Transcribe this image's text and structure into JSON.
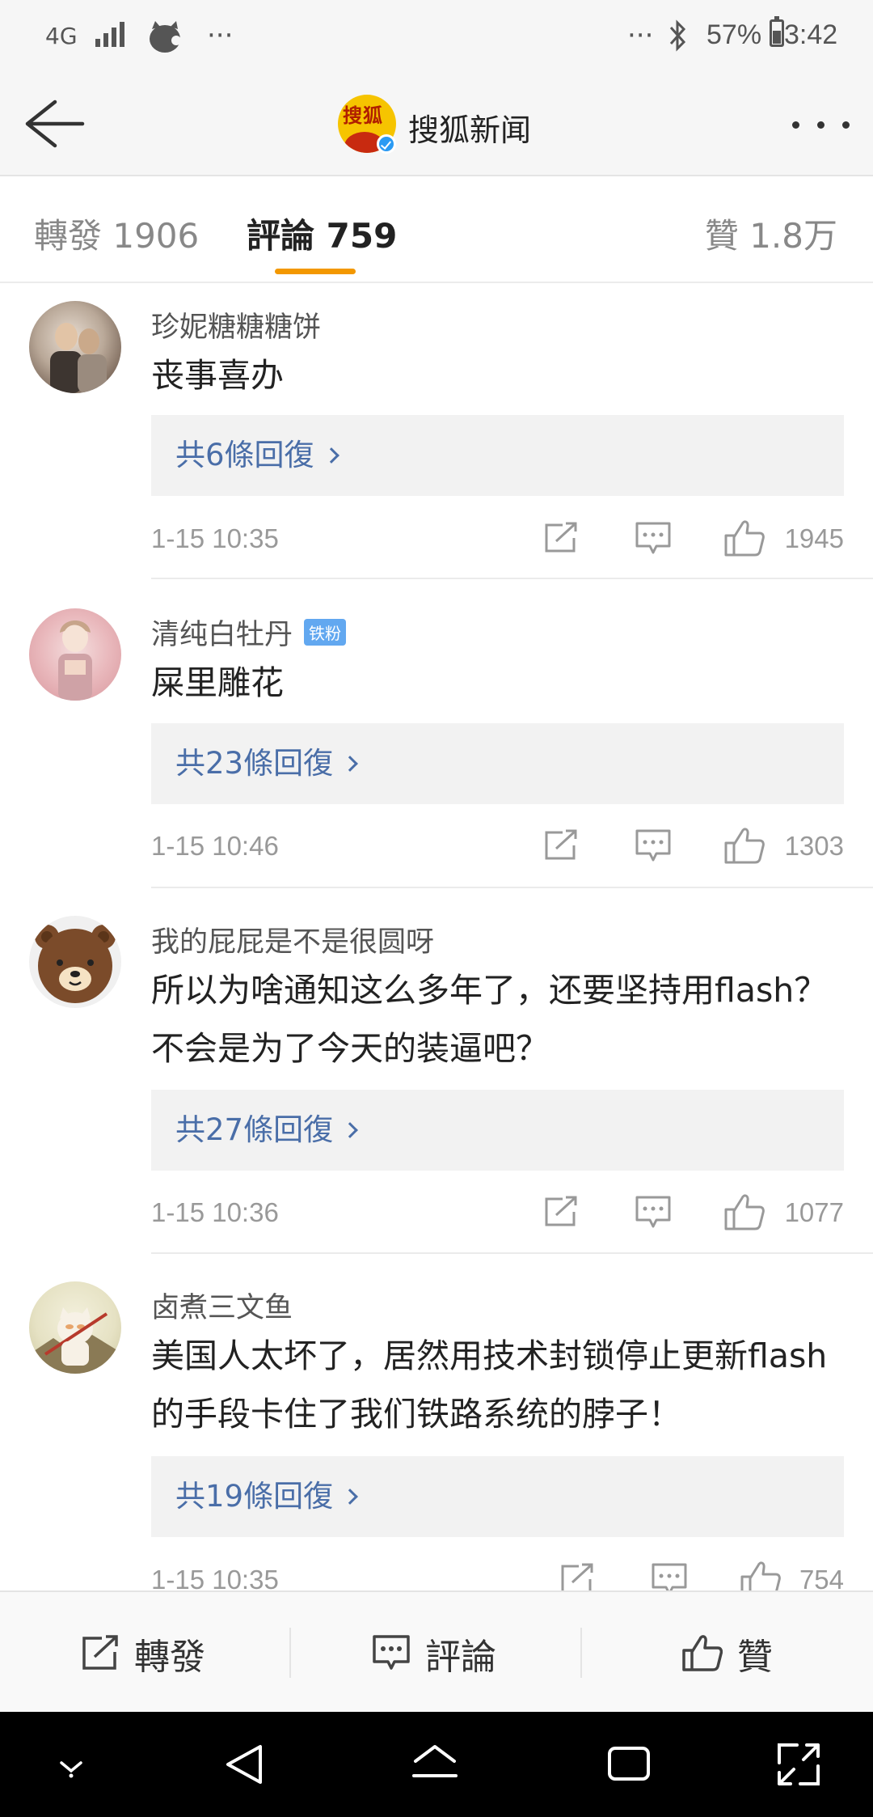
{
  "status_bar": {
    "network": "4G",
    "overflow_left": "···",
    "overflow_right": "···",
    "battery_percent": "57%",
    "battery_level": 0.57,
    "time": "3:42",
    "icons": [
      "signal-bars-icon",
      "cat-app-icon",
      "bluetooth-icon",
      "battery-icon"
    ]
  },
  "header": {
    "title": "搜狐新闻",
    "logo_text": "搜狐",
    "icons": [
      "back-arrow-icon",
      "verified-icon",
      "more-dots-icon"
    ]
  },
  "tabs": [
    {
      "label": "轉發 1906",
      "active": false
    },
    {
      "label": "評論 759",
      "active": true
    },
    {
      "label": "贊 1.8万",
      "active": false
    }
  ],
  "accent_color": "#f39800",
  "link_color": "#4a6ea8",
  "comments": [
    {
      "username": "珍妮糖糖糖饼",
      "badge": "",
      "text": "丧事喜办",
      "replies": "共6條回復",
      "time": "1-15 10:35",
      "likes": "1945"
    },
    {
      "username": "清纯白牡丹",
      "badge": "铁粉",
      "text": "屎里雕花",
      "replies": "共23條回復",
      "time": "1-15 10:46",
      "likes": "1303"
    },
    {
      "username": "我的屁屁是不是很圆呀",
      "badge": "",
      "text": "所以为啥通知这么多年了，还要坚持用flash？ 不会是为了今天的装逼吧？",
      "replies": "共27條回復",
      "time": "1-15 10:36",
      "likes": "1077"
    },
    {
      "username": "卤煮三文鱼",
      "badge": "",
      "text": "美国人太坏了，居然用技术封锁停止更新flash的手段卡住了我们铁路系统的脖子！",
      "replies": "共19條回復",
      "time": "1-15 10:35",
      "likes": "754"
    }
  ],
  "bottom_bar": {
    "forward": "轉發",
    "comment": "評論",
    "like": "贊"
  },
  "nav": [
    "chevron-down-icon",
    "back-triangle-icon",
    "home-icon",
    "recents-icon",
    "expand-icon"
  ]
}
